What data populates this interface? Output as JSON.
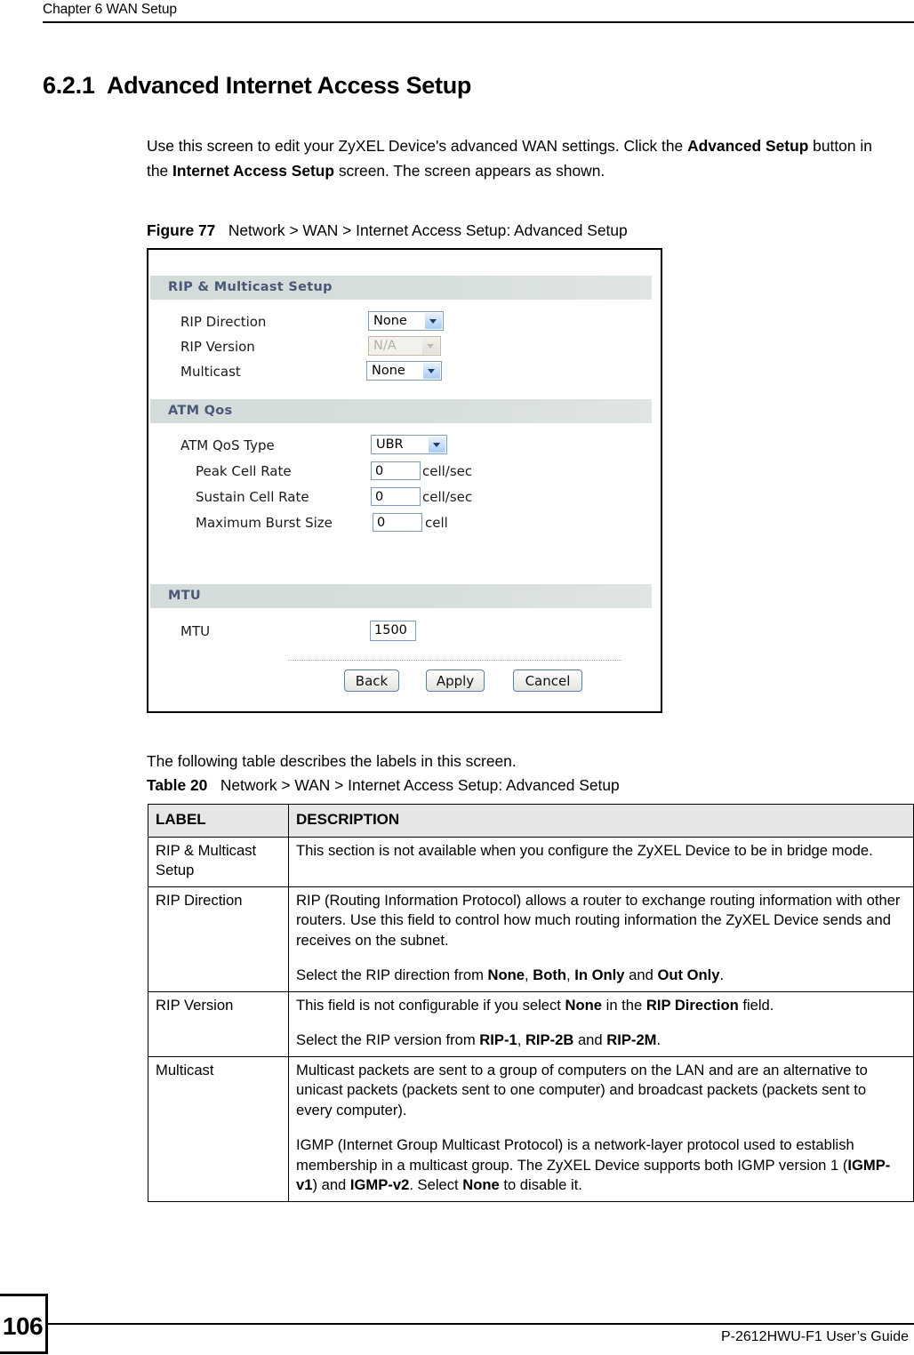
{
  "header": {
    "running_head": "Chapter 6 WAN Setup"
  },
  "heading": {
    "number": "6.2.1",
    "title": "Advanced Internet Access Setup",
    "full": "6.2.1  Advanced Internet Access Setup"
  },
  "intro": {
    "part1": "Use this screen to edit your ZyXEL Device's advanced WAN settings. Click the ",
    "bold1": "Advanced Setup",
    "part2": " button in the ",
    "bold2": "Internet Access Setup",
    "part3": " screen. The screen appears as shown."
  },
  "figure": {
    "caption_label": "Figure 77",
    "caption_text": "Network > WAN > Internet Access Setup: Advanced Setup",
    "sections": {
      "rip": {
        "bar_title": "RIP & Multicast Setup",
        "rip_direction_label": "RIP Direction",
        "rip_direction_value": "None",
        "rip_version_label": "RIP Version",
        "rip_version_value": "N/A",
        "multicast_label": "Multicast",
        "multicast_value": "None"
      },
      "atm": {
        "bar_title": "ATM Qos",
        "qos_type_label": "ATM QoS Type",
        "qos_type_value": "UBR",
        "peak_cell_rate_label": "Peak Cell Rate",
        "peak_cell_rate_value": "0",
        "peak_cell_rate_unit": "cell/sec",
        "sustain_cell_rate_label": "Sustain Cell Rate",
        "sustain_cell_rate_value": "0",
        "sustain_cell_rate_unit": "cell/sec",
        "max_burst_size_label": "Maximum Burst Size",
        "max_burst_size_value": "0",
        "max_burst_size_unit": "cell"
      },
      "mtu": {
        "bar_title": "MTU",
        "mtu_label": "MTU",
        "mtu_value": "1500"
      }
    },
    "buttons": {
      "back": "Back",
      "apply": "Apply",
      "cancel": "Cancel"
    },
    "colors": {
      "section_bar": "#d6dedd",
      "section_bar_text": "#4a5878",
      "control_border": "#7f9db9",
      "select_button": "#a9cdf2"
    }
  },
  "following_text": "The following table describes the labels in this screen.",
  "table": {
    "caption_label": "Table 20",
    "caption_text": "Network > WAN > Internet Access Setup: Advanced Setup",
    "columns": [
      "LABEL",
      "DESCRIPTION"
    ],
    "rows": [
      {
        "label": "RIP & Multicast Setup",
        "p1_a": "This section is not available when you configure the ZyXEL Device to be in bridge mode.",
        "p2_a": ""
      },
      {
        "label": "RIP Direction",
        "p1_a": "RIP (Routing Information Protocol) allows a router to exchange routing information with other routers. Use this field to control how much routing information the ZyXEL Device sends and receives on the subnet.",
        "p2_a": "Select the RIP direction from ",
        "p2_b1": "None",
        "p2_c": ", ",
        "p2_b2": "Both",
        "p2_d": ", ",
        "p2_b3": "In Only",
        "p2_e": " and ",
        "p2_b4": "Out Only",
        "p2_f": "."
      },
      {
        "label": "RIP Version",
        "p1_a": "This field is not configurable if you select ",
        "p1_b1": "None",
        "p1_c": " in the ",
        "p1_b2": "RIP Direction",
        "p1_d": " field.",
        "p2_a": "Select the RIP version from ",
        "p2_b1": "RIP-1",
        "p2_c": ", ",
        "p2_b2": "RIP-2B",
        "p2_d": " and ",
        "p2_b3": "RIP-2M",
        "p2_e": "."
      },
      {
        "label": "Multicast",
        "p1_a": "Multicast packets are sent to a group of computers on the LAN and are an alternative to unicast packets (packets sent to one computer) and broadcast packets (packets sent to every computer).",
        "p2_a": "IGMP (Internet Group Multicast Protocol) is a network-layer protocol used to establish membership in a multicast group. The ZyXEL Device supports both IGMP version 1 (",
        "p2_b1": "IGMP-v1",
        "p2_c": ") and ",
        "p2_b2": "IGMP-v2",
        "p2_d": ". Select ",
        "p2_b3": "None",
        "p2_e": " to disable it."
      }
    ]
  },
  "footer": {
    "page_number": "106",
    "guide_title": "P-2612HWU-F1 User’s Guide"
  }
}
